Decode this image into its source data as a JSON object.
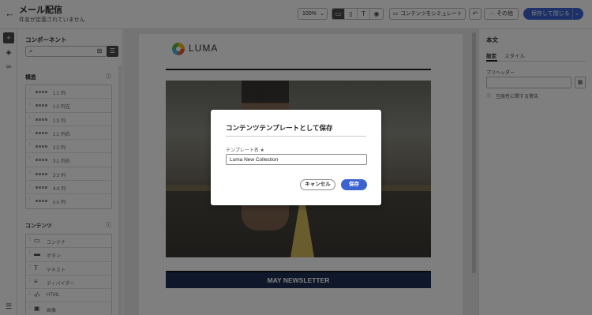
{
  "header": {
    "back_icon": "arrow-left-icon",
    "title": "メール配信",
    "subtitle": "件名が定義されていません",
    "zoom": "100%",
    "simulate_label": "コンテンツをシミュレート",
    "more_label": "その他",
    "save_close_label": "保存して閉じる",
    "accent_color": "#3b63d0"
  },
  "rail": {
    "items": [
      "plus-icon",
      "layers-icon",
      "link-icon",
      "tree-icon"
    ]
  },
  "components": {
    "title": "コンポーネント",
    "structure_title": "構造",
    "structures": [
      "1:1 列",
      "1:2 列左",
      "1:3 列",
      "2:1 列右",
      "2:2 列",
      "3:1 列右",
      "3:3 列",
      "4:4 列",
      "n:n 列"
    ],
    "content_title": "コンテンツ",
    "contents": [
      {
        "icon": "container-icon",
        "label": "コンテナ"
      },
      {
        "icon": "button-icon",
        "label": "ボタン"
      },
      {
        "icon": "text-icon",
        "label": "テキスト"
      },
      {
        "icon": "divider-icon",
        "label": "ディバイダー"
      },
      {
        "icon": "html-icon",
        "label": "HTML"
      },
      {
        "icon": "image-icon",
        "label": "画像"
      }
    ]
  },
  "email": {
    "logo_text": "LUMA",
    "newsletter_text": "MAY NEWSLETTER"
  },
  "right_panel": {
    "title": "本文",
    "tab_settings": "設定",
    "tab_style": "スタイル",
    "preheader_label": "プリヘッダー",
    "compat_text": "互換性に関する警告"
  },
  "modal": {
    "title": "コンテンツテンプレートとして保存",
    "field_label": "テンプレート名 ★",
    "field_value": "Luma New Collection",
    "cancel_label": "キャンセル",
    "save_label": "保存"
  }
}
